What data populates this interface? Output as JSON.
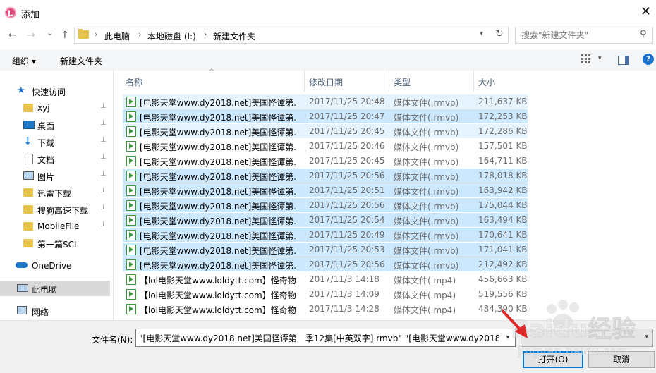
{
  "window": {
    "title": "添加",
    "close_glyph": "✕"
  },
  "nav": {
    "back": "←",
    "forward": "→",
    "recent": "⌄",
    "up": "↑",
    "breadcrumbs": [
      "此电脑",
      "本地磁盘 (I:)",
      "新建文件夹"
    ],
    "separator": "›",
    "search_placeholder": "搜索\"新建文件夹\""
  },
  "toolbar": {
    "organize": "组织 ▾",
    "new_folder": "新建文件夹",
    "view_dropdown": "▾",
    "help": "?"
  },
  "sidebar": {
    "items": [
      {
        "label": "快速访问",
        "icon": "star-icon"
      },
      {
        "label": "xyj",
        "icon": "folder-icon",
        "pinned": true
      },
      {
        "label": "桌面",
        "icon": "desktop-icon",
        "pinned": true
      },
      {
        "label": "下载",
        "icon": "download-icon",
        "pinned": true
      },
      {
        "label": "文档",
        "icon": "document-icon",
        "pinned": true
      },
      {
        "label": "图片",
        "icon": "picture-icon",
        "pinned": true
      },
      {
        "label": "迅雷下载",
        "icon": "folder-icon",
        "pinned": true
      },
      {
        "label": "搜狗高速下载",
        "icon": "folder-icon",
        "pinned": true
      },
      {
        "label": "MobileFile",
        "icon": "folder-icon",
        "pinned": true
      },
      {
        "label": "第一篇SCI",
        "icon": "folder-icon"
      },
      {
        "label": "OneDrive",
        "icon": "cloud-icon"
      },
      {
        "label": "此电脑",
        "icon": "computer-icon"
      },
      {
        "label": "网络",
        "icon": "network-icon"
      }
    ],
    "pin_glyph": "📌"
  },
  "columns": {
    "name": "名称",
    "date": "修改日期",
    "type": "类型",
    "size": "大小",
    "sort_glyph": "^"
  },
  "files": [
    {
      "name": "[电影天堂www.dy2018.net]美国怪谭第...",
      "date": "2017/11/25 20:48",
      "type": "媒体文件(.rmvb)",
      "size": "211,637 KB"
    },
    {
      "name": "[电影天堂www.dy2018.net]美国怪谭第...",
      "date": "2017/11/25 20:47",
      "type": "媒体文件(.rmvb)",
      "size": "172,253 KB"
    },
    {
      "name": "[电影天堂www.dy2018.net]美国怪谭第...",
      "date": "2017/11/25 20:45",
      "type": "媒体文件(.rmvb)",
      "size": "172,286 KB"
    },
    {
      "name": "[电影天堂www.dy2018.net]美国怪谭第...",
      "date": "2017/11/25 20:46",
      "type": "媒体文件(.rmvb)",
      "size": "157,501 KB"
    },
    {
      "name": "[电影天堂www.dy2018.net]美国怪谭第...",
      "date": "2017/11/25 20:45",
      "type": "媒体文件(.rmvb)",
      "size": "164,711 KB"
    },
    {
      "name": "[电影天堂www.dy2018.net]美国怪谭第...",
      "date": "2017/11/25 20:56",
      "type": "媒体文件(.rmvb)",
      "size": "178,018 KB"
    },
    {
      "name": "[电影天堂www.dy2018.net]美国怪谭第...",
      "date": "2017/11/25 20:51",
      "type": "媒体文件(.rmvb)",
      "size": "163,942 KB"
    },
    {
      "name": "[电影天堂www.dy2018.net]美国怪谭第...",
      "date": "2017/11/25 20:56",
      "type": "媒体文件(.rmvb)",
      "size": "175,044 KB"
    },
    {
      "name": "[电影天堂www.dy2018.net]美国怪谭第...",
      "date": "2017/11/25 20:54",
      "type": "媒体文件(.rmvb)",
      "size": "163,494 KB"
    },
    {
      "name": "[电影天堂www.dy2018.net]美国怪谭第...",
      "date": "2017/11/25 20:49",
      "type": "媒体文件(.rmvb)",
      "size": "170,641 KB"
    },
    {
      "name": "[电影天堂www.dy2018.net]美国怪谭第...",
      "date": "2017/11/25 20:53",
      "type": "媒体文件(.rmvb)",
      "size": "171,041 KB"
    },
    {
      "name": "[电影天堂www.dy2018.net]美国怪谭第...",
      "date": "2017/11/25 20:56",
      "type": "媒体文件(.rmvb)",
      "size": "212,492 KB"
    },
    {
      "name": "【lol电影天堂www.loldytt.com】怪奇物...",
      "date": "2017/11/3 14:18",
      "type": "媒体文件(.mp4)",
      "size": "456,663 KB"
    },
    {
      "name": "【lol电影天堂www.loldytt.com】怪奇物...",
      "date": "2017/11/3 14:09",
      "type": "媒体文件(.mp4)",
      "size": "519,556 KB"
    },
    {
      "name": "【lol电影天堂www.loldytt.com】怪奇物...",
      "date": "2017/11/3 14:28",
      "type": "媒体文件(.mp4)",
      "size": "484,390 KB"
    }
  ],
  "row_states": [
    "hover",
    "selected",
    "hover",
    "none",
    "none",
    "selected",
    "selected",
    "selected",
    "selected",
    "selected",
    "selected",
    "selected",
    "none",
    "none",
    "none"
  ],
  "bottom": {
    "filename_label": "文件名(N):",
    "filename_value": "\"[电影天堂www.dy2018.net]美国怪谭第一季12集[中英双字].rmvb\" \"[电影天堂www.dy2018.net",
    "dropdown_glyph": "▾",
    "open": "打开(O)",
    "cancel": "取消"
  },
  "watermark": {
    "text": "Baidu经验",
    "url": "jingyan.baidu.com"
  }
}
